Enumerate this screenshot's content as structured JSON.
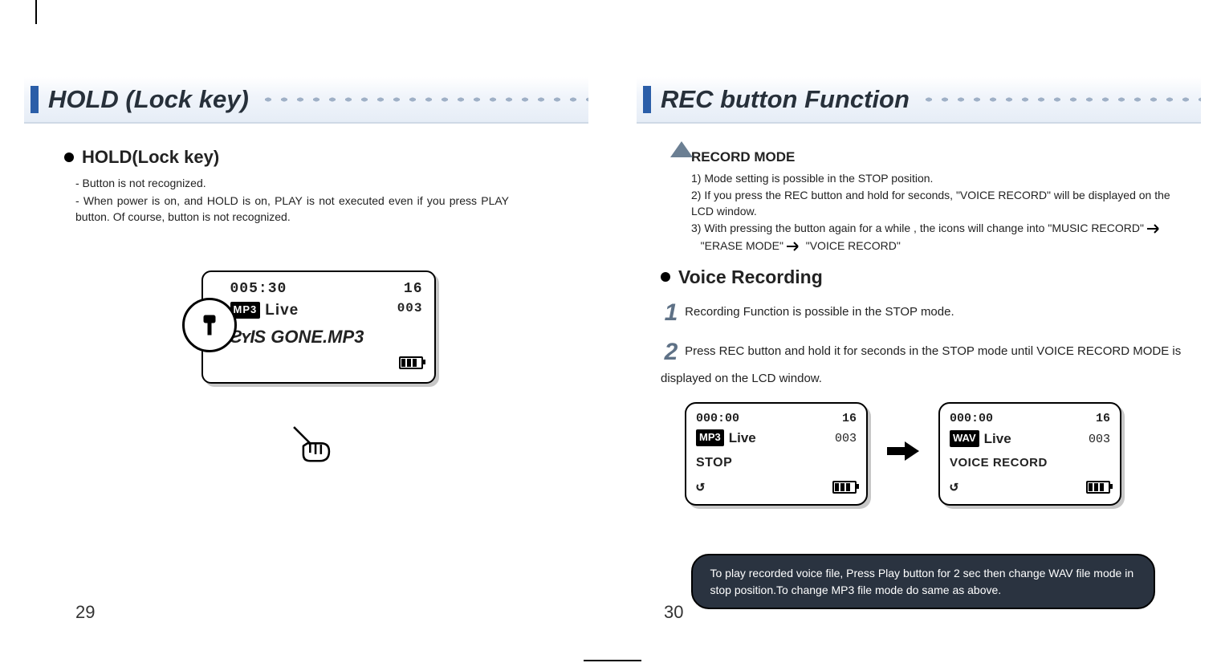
{
  "left": {
    "title": "HOLD (Lock key)",
    "sub": "HOLD(Lock key)",
    "bullet1": "- Button is not recognized.",
    "bullet2": "- When power is on, and HOLD is on, PLAY is not executed even if you press PLAY button. Of course, button is not recognized.",
    "lcd": {
      "time": "005:30",
      "count": "16",
      "badge": "MP3",
      "live": "Live",
      "track": "003",
      "song": "S GONE.MP3"
    },
    "pagenum": "29"
  },
  "right": {
    "title": "REC button Function",
    "recmode_head": "RECORD MODE",
    "rm1": "1) Mode setting is possible in the STOP position.",
    "rm2": "2) If you press the REC button and hold for seconds, \"VOICE RECORD\"  will be displayed on the LCD window.",
    "rm3a": "3) With pressing the button again for a while , the icons will change into \"MUSIC RECORD\"",
    "rm3b": "\"ERASE MODE\"",
    "rm3c": "\"VOICE RECORD\"",
    "voice_head": "Voice Recording",
    "step1": "Recording Function is possible in the STOP mode.",
    "step2": "Press REC button and hold it for seconds in the STOP mode until VOICE RECORD MODE is displayed on the LCD window.",
    "lcdA": {
      "time": "000:00",
      "count": "16",
      "badge": "MP3",
      "live": "Live",
      "track": "003",
      "mode": "STOP"
    },
    "lcdB": {
      "time": "000:00",
      "count": "16",
      "badge": "WAV",
      "live": "Live",
      "track": "003",
      "mode": "VOICE RECORD"
    },
    "tip": "To play recorded voice file, Press Play button for 2 sec then change WAV file mode in stop position.To change MP3 file mode do same as above.",
    "pagenum": "30"
  }
}
